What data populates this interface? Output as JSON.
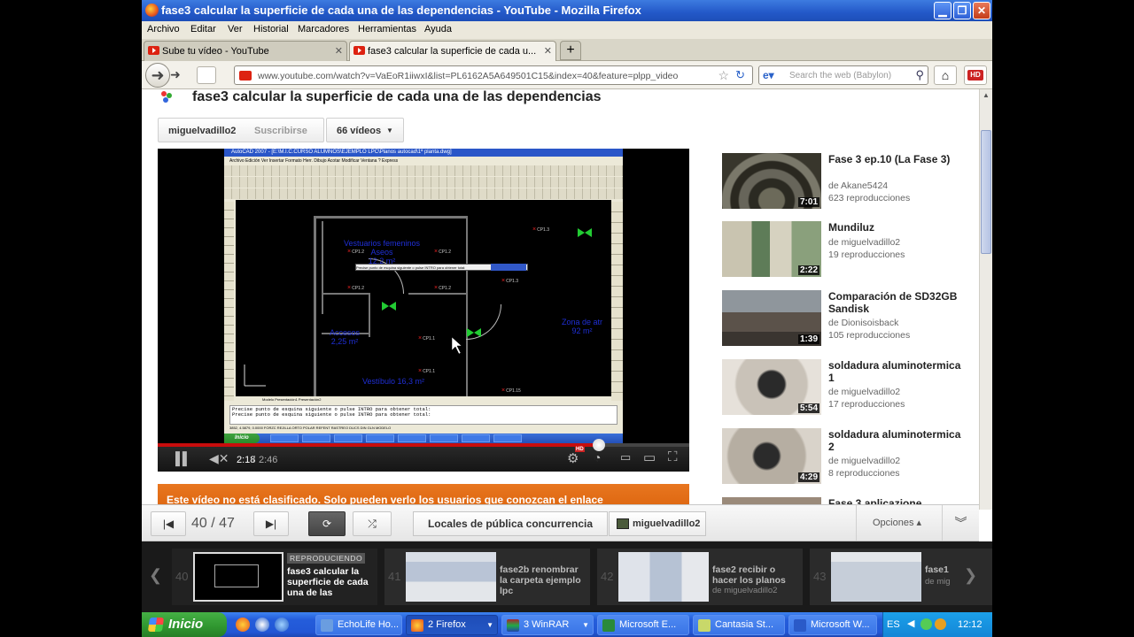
{
  "window": {
    "title": "fase3 calcular la superficie de cada una de las dependencias - YouTube - Mozilla Firefox",
    "controls": {
      "minimize": "▁",
      "maximize": "❐",
      "close": "✕"
    }
  },
  "menu": [
    "Archivo",
    "Editar",
    "Ver",
    "Historial",
    "Marcadores",
    "Herramientas",
    "Ayuda"
  ],
  "tabs": [
    {
      "label": "Sube tu vídeo - YouTube",
      "active": false
    },
    {
      "label": "fase3 calcular la superficie de cada u...",
      "active": true
    }
  ],
  "newtab": "+",
  "nav": {
    "url": "www.youtube.com/watch?v=VaEoR1iiwxI&list=PL6162A5A649501C15&index=40&feature=plpp_video",
    "search_placeholder": "Search the web (Babylon)",
    "hd_label": "HD"
  },
  "video": {
    "title": "fase3 calcular la superficie de cada una de las dependencias",
    "channel": "miguelvadillo2",
    "subscribe": "Suscribirse",
    "videos_button": "66 vídeos",
    "time_current": "2:18",
    "time_sep": " / ",
    "time_total": "2:46",
    "progress": 0.83,
    "hd_badge": "HD"
  },
  "acad": {
    "title": "AutoCAD 2007 - [E:\\M.I.C.CURSO ALUMNOS\\EJEMPLO LPC\\Planos autocad\\1ª planta.dwg]",
    "menu": "Archivo  Edición  Ver  Insertar  Formato  Herr.  Dibujo  Acotar  Modificar  Ventana  ?  Express",
    "rooms": [
      {
        "label": "Vestuarios femeninos\nAseos\n12,2 m²"
      },
      {
        "label": "Accesos\n2,25 m²"
      },
      {
        "label": "Vestíbulo 16,3 m²"
      },
      {
        "label": "Zona de atr\n92 m²"
      }
    ],
    "cp": [
      "CP1.2",
      "CP1.2",
      "CP1.2",
      "CP1.2",
      "CP1.3",
      "CP1.1",
      "CP1.1",
      "CP1.15",
      "CP1.3"
    ],
    "tooltip": "Precise punto de esquina siguiente o pulse INTRO para obtener total:",
    "tabs": "Modelo   Presentación1   Presentación2",
    "cmd_lines": [
      "Precise punto de esquina siguiente o pulse INTRO para obtener total:",
      "Precise punto de esquina siguiente o pulse INTRO para obtener total:"
    ],
    "status": "3852, 4.5879, 0.0000     FORZC  REJILLA  ORTO  POLAR  REFENT  RASTREO  DUCS  DIN  GLN  MODELO",
    "start": "Inicio"
  },
  "notice": "Este vídeo no está clasificado. Solo pueden verlo los usuarios que conozcan el enlace",
  "related": [
    {
      "title": "Fase 3 ep.10 (La Fase 3)",
      "author": "de Akane5424",
      "views": "623 reproducciones",
      "duration": "7:01"
    },
    {
      "title": "Mundiluz",
      "author": "de miguelvadillo2",
      "views": "19 reproducciones",
      "duration": "2:22"
    },
    {
      "title": "Comparación de SD32GB Sandisk",
      "author": "de Dionisoisback",
      "views": "105 reproducciones",
      "duration": "1:39"
    },
    {
      "title": "soldadura aluminotermica 1",
      "author": "de miguelvadillo2",
      "views": "17 reproducciones",
      "duration": "5:54"
    },
    {
      "title": "soldadura aluminotermica 2",
      "author": "de miguelvadillo2",
      "views": "8 reproducciones",
      "duration": "4:29"
    },
    {
      "title": "Fase 3 aplicazione",
      "author": "",
      "views": "",
      "duration": ""
    }
  ],
  "playlist": {
    "position": "40 / 47",
    "title": "Locales de pública concurrencia",
    "owner": "miguelvadillo2",
    "options": "Opciones ▴",
    "items": [
      {
        "num": "40",
        "title": "fase3 calcular la superficie de cada una de las",
        "author": "",
        "now_playing": "REPRODUCIENDO"
      },
      {
        "num": "41",
        "title": "fase2b renombrar la carpeta ejemplo lpc",
        "author": ""
      },
      {
        "num": "42",
        "title": "fase2 recibir o hacer los planos",
        "author": "de miguelvadillo2"
      },
      {
        "num": "43",
        "title": "fase1",
        "author": "de mig"
      }
    ]
  },
  "taskbar": {
    "start": "Inicio",
    "buttons": [
      {
        "label": "EchoLife Ho...",
        "active": false
      },
      {
        "label": "2 Firefox",
        "active": true
      },
      {
        "label": "3 WinRAR",
        "active": false
      },
      {
        "label": "Microsoft E...",
        "active": false
      },
      {
        "label": "Cantasia St...",
        "active": false
      },
      {
        "label": "Microsoft W...",
        "active": false
      }
    ],
    "lang": "ES",
    "clock": "12:12"
  }
}
